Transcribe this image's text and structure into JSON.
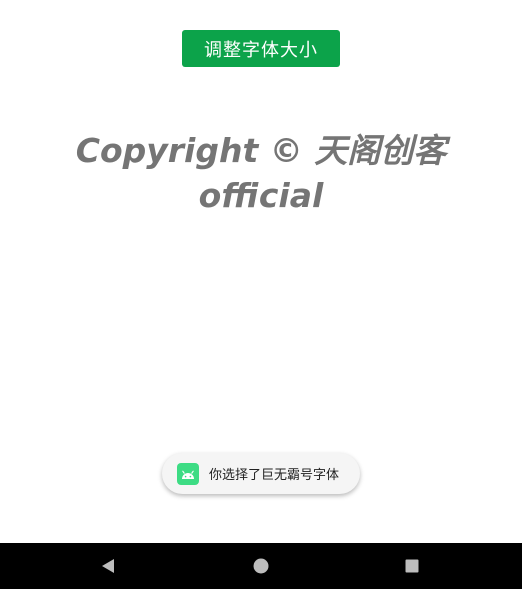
{
  "app": {
    "adjust_button_label": "调整字体大小",
    "copyright_text": "Copyright © 天阁创客 official"
  },
  "toast": {
    "message": "你选择了巨无霸号字体",
    "icon": "android-icon"
  },
  "navbar": {
    "back_icon": "back-triangle-icon",
    "home_icon": "home-circle-icon",
    "recents_icon": "recents-square-icon"
  },
  "colors": {
    "button": "#0ca34a",
    "text": "#757575",
    "toast_bg": "#f5f5f5",
    "navbar": "#000000"
  }
}
